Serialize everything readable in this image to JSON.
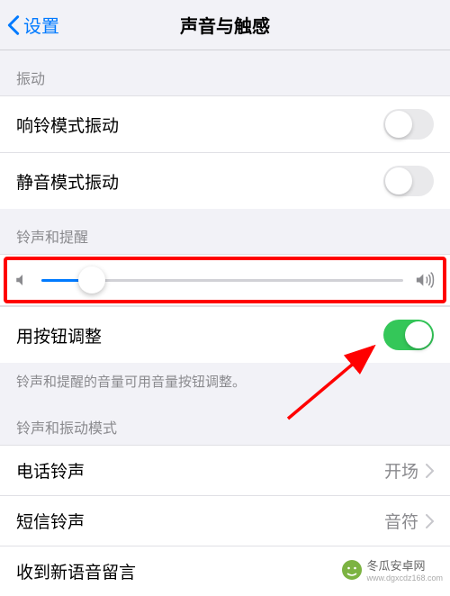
{
  "header": {
    "back_label": "设置",
    "title": "声音与触感"
  },
  "sections": {
    "vibration": {
      "header": "振动",
      "ring_vibrate": "响铃模式振动",
      "silent_vibrate": "静音模式振动"
    },
    "ringtone_alert": {
      "header": "铃声和提醒",
      "button_adjust": "用按钮调整",
      "footer": "铃声和提醒的音量可用音量按钮调整。"
    },
    "sound_patterns": {
      "header": "铃声和振动模式",
      "phone_ringtone": {
        "label": "电话铃声",
        "value": "开场"
      },
      "text_tone": {
        "label": "短信铃声",
        "value": "音符"
      },
      "voicemail": {
        "label": "收到新语音留言"
      }
    }
  },
  "toggles": {
    "ring_vibrate": false,
    "silent_vibrate": false,
    "button_adjust": true
  },
  "slider": {
    "value": 14,
    "min": 0,
    "max": 100
  },
  "watermark": {
    "text": "冬瓜安卓网",
    "url": "www.dgxcdz168.com"
  }
}
